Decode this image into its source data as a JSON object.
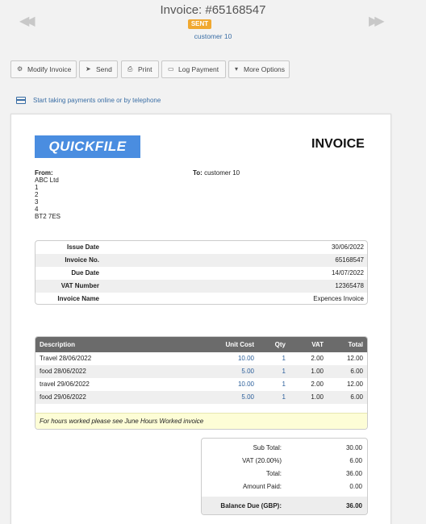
{
  "header": {
    "title": "Invoice: #65168547",
    "status": "SENT",
    "customer": "customer 10",
    "prev_icon": "double-chevron-left-icon",
    "next_icon": "double-chevron-right-icon"
  },
  "toolbar": {
    "modify": "Modify Invoice",
    "send": "Send",
    "print": "Print",
    "log_payment": "Log Payment",
    "more": "More Options"
  },
  "payments_link": "Start taking payments online or by telephone",
  "invoice": {
    "logo_text": "QUICKFILE",
    "heading": "INVOICE",
    "from_label": "From:",
    "from_lines": [
      "ABC Ltd",
      "1",
      "2",
      "3",
      "4",
      "BT2 7ES"
    ],
    "to_label": "To:",
    "to_value": "customer 10",
    "meta": [
      {
        "label": "Issue Date",
        "value": "30/06/2022"
      },
      {
        "label": "Invoice No.",
        "value": "65168547"
      },
      {
        "label": "Due Date",
        "value": "14/07/2022"
      },
      {
        "label": "VAT Number",
        "value": "12365478"
      },
      {
        "label": "Invoice Name",
        "value": "Expences Invoice"
      }
    ],
    "items_headers": {
      "desc": "Description",
      "unit": "Unit Cost",
      "qty": "Qty",
      "vat": "VAT",
      "total": "Total"
    },
    "items": [
      {
        "desc": "Travel 28/06/2022",
        "unit": "10.00",
        "qty": "1",
        "vat": "2.00",
        "total": "12.00"
      },
      {
        "desc": "food 28/06/2022",
        "unit": "5.00",
        "qty": "1",
        "vat": "1.00",
        "total": "6.00"
      },
      {
        "desc": "travel 29/06/2022",
        "unit": "10.00",
        "qty": "1",
        "vat": "2.00",
        "total": "12.00"
      },
      {
        "desc": "food 29/06/2022",
        "unit": "5.00",
        "qty": "1",
        "vat": "1.00",
        "total": "6.00"
      }
    ],
    "items_note": "For hours worked please see June Hours Worked invoice",
    "totals": [
      {
        "label": "Sub Total:",
        "value": "30.00"
      },
      {
        "label": "VAT (20.00%)",
        "value": "6.00"
      },
      {
        "label": "Total:",
        "value": "36.00"
      },
      {
        "label": "Amount Paid:",
        "value": "0.00"
      }
    ],
    "balance": {
      "label": "Balance Due (GBP):",
      "value": "36.00"
    }
  },
  "colors": {
    "badge": "#f0a830",
    "link": "#3a6ea5",
    "logo_bg": "#4a8de0",
    "table_head": "#6b6b6b",
    "note_bg": "#fdfdd6"
  }
}
